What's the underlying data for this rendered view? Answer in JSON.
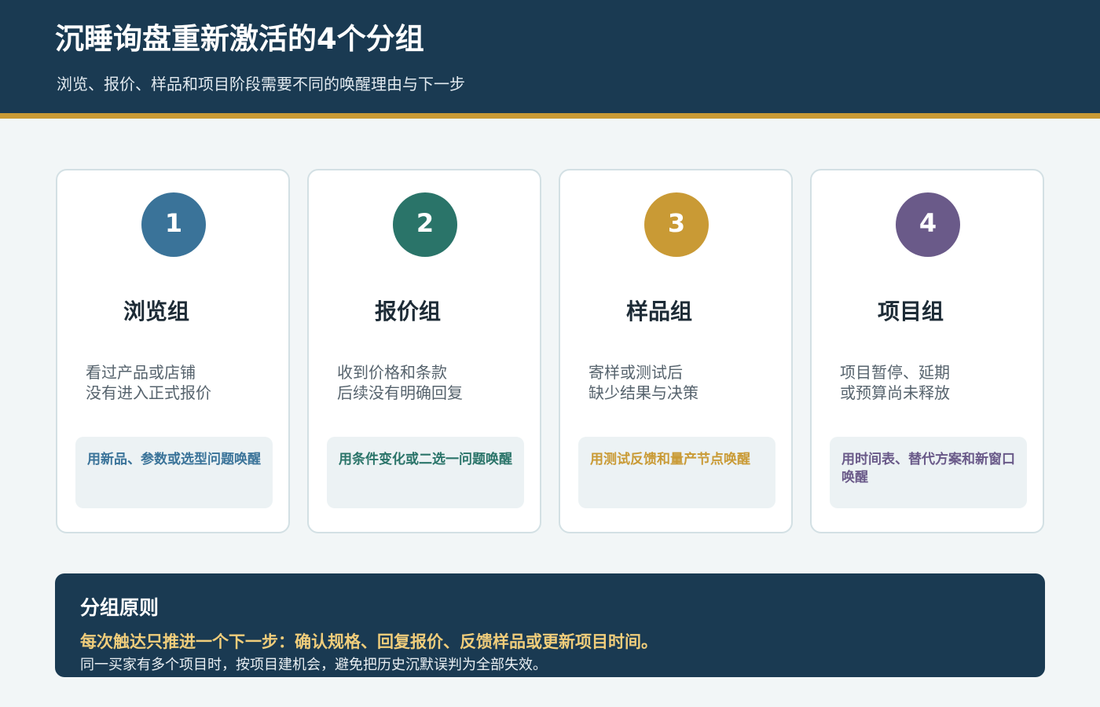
{
  "header": {
    "title": "沉睡询盘重新激活的4个分组",
    "subtitle": "浏览、报价、样品和项目阶段需要不同的唤醒理由与下一步"
  },
  "colors": {
    "header_bg": "#1a3a52",
    "accent_gold": "#c99a35",
    "group_1": "#3a7399",
    "group_2": "#2a7469",
    "group_3": "#c99a35",
    "group_4": "#6a5a89",
    "highlight_text": "#f0cd7b"
  },
  "groups": [
    {
      "number": "1",
      "name": "浏览组",
      "description": [
        "看过产品或店铺",
        "没有进入正式报价"
      ],
      "action": "用新品、参数或选型问题唤醒"
    },
    {
      "number": "2",
      "name": "报价组",
      "description": [
        "收到价格和条款",
        "后续没有明确回复"
      ],
      "action": "用条件变化或二选一问题唤醒"
    },
    {
      "number": "3",
      "name": "样品组",
      "description": [
        "寄样或测试后",
        "缺少结果与决策"
      ],
      "action": "用测试反馈和量产节点唤醒"
    },
    {
      "number": "4",
      "name": "项目组",
      "description": [
        "项目暂停、延期",
        "或预算尚未释放"
      ],
      "action": "用时间表、替代方案和新窗口唤醒"
    }
  ],
  "principles": {
    "title": "分组原则",
    "highlight": "每次触达只推进一个下一步：确认规格、回复报价、反馈样品或更新项目时间。",
    "body": "同一买家有多个项目时，按项目建机会，避免把历史沉默误判为全部失效。"
  }
}
